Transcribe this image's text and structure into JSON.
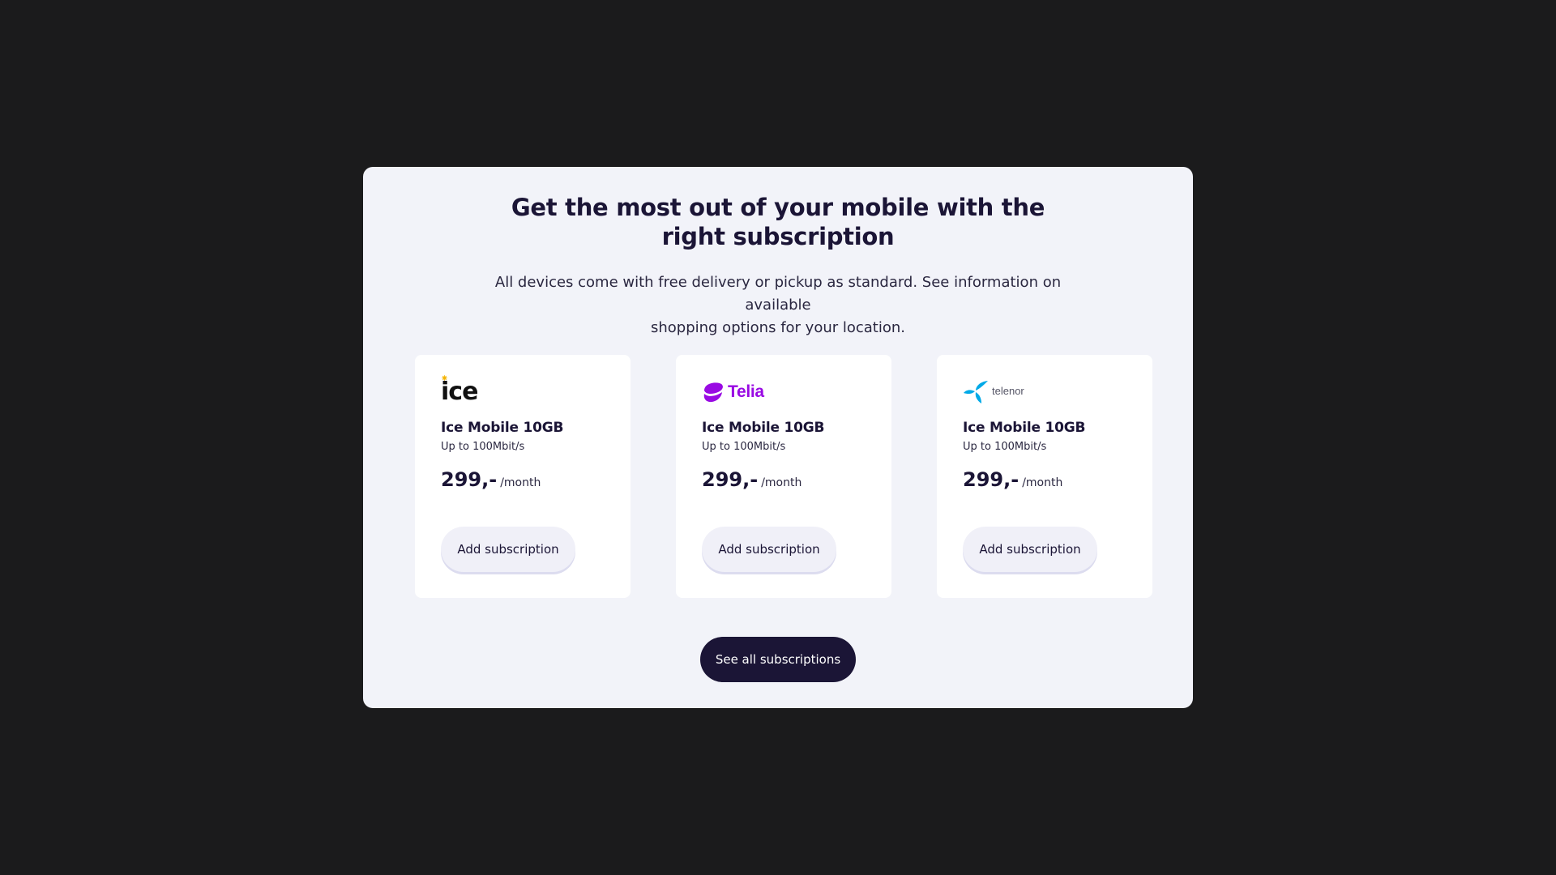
{
  "modal": {
    "title_line1": "Get the most out of your mobile with the",
    "title_line2": "right subscription",
    "subtitle_line1": "All devices come with free delivery or pickup as standard. See information on available",
    "subtitle_line2": "shopping options for your location."
  },
  "cards": [
    {
      "logo_text": "ice",
      "logo_icon": "ice-logo",
      "name": "Ice Mobile 10GB",
      "speed": "Up to 100Mbit/s",
      "price": "299,-",
      "price_unit": "/month",
      "button_label": "Add subscription"
    },
    {
      "logo_text": "Telia",
      "logo_icon": "telia-logo",
      "name": "Ice Mobile 10GB",
      "speed": "Up to 100Mbit/s",
      "price": "299,-",
      "price_unit": "/month",
      "button_label": "Add subscription"
    },
    {
      "logo_text": "telenor",
      "logo_icon": "telenor-logo",
      "name": "Ice Mobile 10GB",
      "speed": "Up to 100Mbit/s",
      "price": "299,-",
      "price_unit": "/month",
      "button_label": "Add subscription"
    }
  ],
  "see_all_label": "See all subscriptions",
  "colors": {
    "backdrop": "#1b1b1c",
    "modal_bg": "#f2f3f9",
    "primary": "#1b1536",
    "telia": "#990ae3",
    "telenor": "#00a9e7",
    "ice_accent": "#f4b400"
  }
}
